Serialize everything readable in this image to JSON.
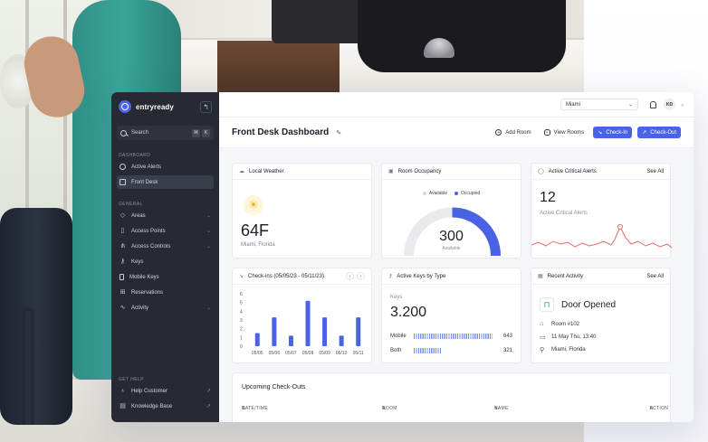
{
  "sidebar": {
    "brand": "entryready",
    "search": {
      "placeholder": "Search",
      "key1": "⌘",
      "key2": "K"
    },
    "dashboard_label": "DASHBOARD",
    "dashboard_items": [
      {
        "label": "Active Alerts"
      },
      {
        "label": "Front Desk"
      }
    ],
    "general_label": "GENERAL",
    "general_items": [
      {
        "label": "Areas"
      },
      {
        "label": "Access Points"
      },
      {
        "label": "Access Controls"
      },
      {
        "label": "Keys"
      },
      {
        "label": "Mobile Keys"
      },
      {
        "label": "Reservations"
      },
      {
        "label": "Activity"
      }
    ],
    "help_label": "GET HELP",
    "help_items": [
      {
        "label": "Help Customer"
      },
      {
        "label": "Knowledge Base"
      }
    ]
  },
  "topbar": {
    "city": "Miami",
    "avatar_initials": "KD"
  },
  "header": {
    "title": "Front Desk Dashboard",
    "add_room": "Add Room",
    "view_rooms": "View Rooms",
    "check_in": "Check-In",
    "check_out": "Check-Out"
  },
  "weather": {
    "title": "Local Weather",
    "temperature": "64F",
    "location": "Miami, Florida"
  },
  "occupancy": {
    "title": "Room Occupancy",
    "legend_available": "Available",
    "legend_occupied": "Occupied",
    "value": "300",
    "sub": "Available",
    "occupied_fraction": 0.5
  },
  "alerts": {
    "title": "Active Critical Alerts",
    "see_all": "See All",
    "count": "12",
    "sub": "Active Critical Alerts"
  },
  "checkins": {
    "title": "Check-ins (05/05/23 - 05/11/23)",
    "prev": "‹",
    "next": "›"
  },
  "chart_data": {
    "type": "bar",
    "categories": [
      "05/05",
      "05/06",
      "05/07",
      "05/08",
      "05/09",
      "05/10",
      "05/11"
    ],
    "values": [
      1.5,
      3.3,
      1.2,
      5.2,
      3.3,
      1.2,
      3.3
    ],
    "ylim": [
      0,
      6
    ],
    "yticks": [
      "0",
      "1",
      "2",
      "3",
      "4",
      "5",
      "6"
    ],
    "title": "Check-ins (05/05/23 - 05/11/23)",
    "xlabel": "",
    "ylabel": ""
  },
  "keys": {
    "title": "Active Keys by Type",
    "label": "Keys",
    "total": "3.200",
    "rows": [
      {
        "label": "Mobile",
        "value": "643"
      },
      {
        "label": "Both",
        "value": "321"
      }
    ]
  },
  "activity": {
    "title": "Recent Activity",
    "see_all": "See All",
    "event": "Door Opened",
    "room": "Room #102",
    "time": "11 May Thu, 13:40",
    "location": "Miami, Florida"
  },
  "checkouts": {
    "title": "Upcoming Check-Outs",
    "col_date": "DATE/TIME",
    "col_room": "ROOM",
    "col_name": "NAME",
    "col_action": "ACTION"
  },
  "colors": {
    "accent": "#4a62e6",
    "sidebar": "#272a33",
    "alert_line": "#e46a6a",
    "gauge_track": "#e9eaee"
  }
}
